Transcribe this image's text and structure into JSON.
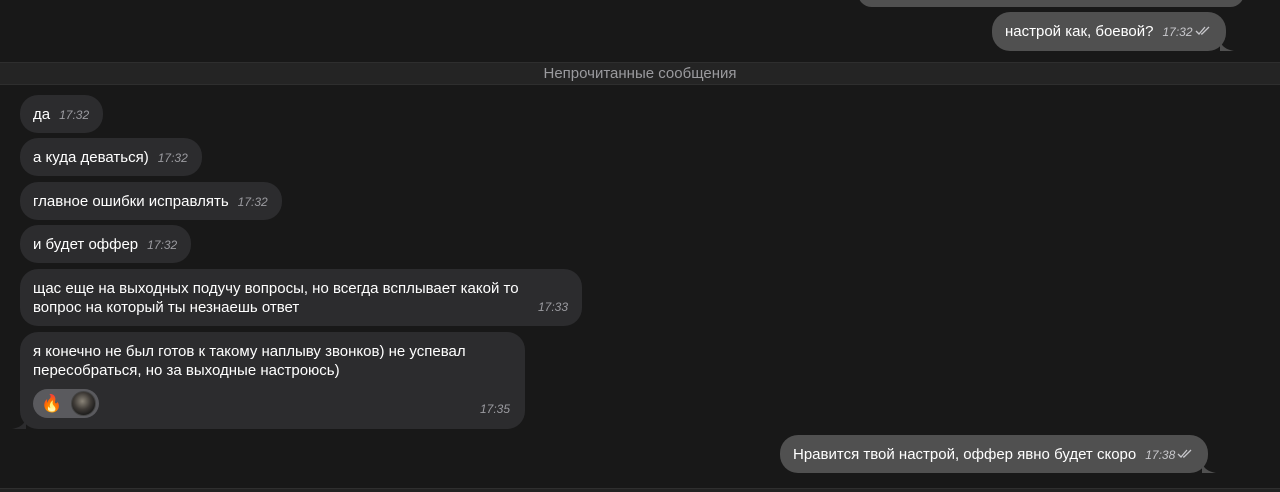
{
  "divider": {
    "label": "Непрочитанные сообщения"
  },
  "messages": [
    {
      "direction": "out",
      "text": "настрой как, боевой?",
      "time": "17:32",
      "status": "read"
    },
    {
      "direction": "in",
      "text": "да",
      "time": "17:32"
    },
    {
      "direction": "in",
      "text": "а куда деваться)",
      "time": "17:32"
    },
    {
      "direction": "in",
      "text": "главное ошибки исправлять",
      "time": "17:32"
    },
    {
      "direction": "in",
      "text": "и будет оффер",
      "time": "17:32"
    },
    {
      "direction": "in",
      "text": "щас еще на выходных подучу вопросы, но всегда всплывает какой то\nвопрос на который ты незнаешь ответ",
      "time": "17:33"
    },
    {
      "direction": "in",
      "text": "я конечно не был готов к такому наплыву звонков) не успевал\nпересобраться, но за выходные настроюсь)",
      "time": "17:35",
      "reactions": [
        {
          "emoji": "🔥",
          "icon": "fire-icon"
        }
      ]
    },
    {
      "direction": "out",
      "text": "Нравится твой настрой, оффер явно будет скоро",
      "time": "17:38",
      "status": "read"
    }
  ],
  "colors": {
    "background": "#181818",
    "incoming_bubble": "#2c2c2e",
    "outgoing_bubble": "#505050",
    "divider_bar": "#242424"
  }
}
